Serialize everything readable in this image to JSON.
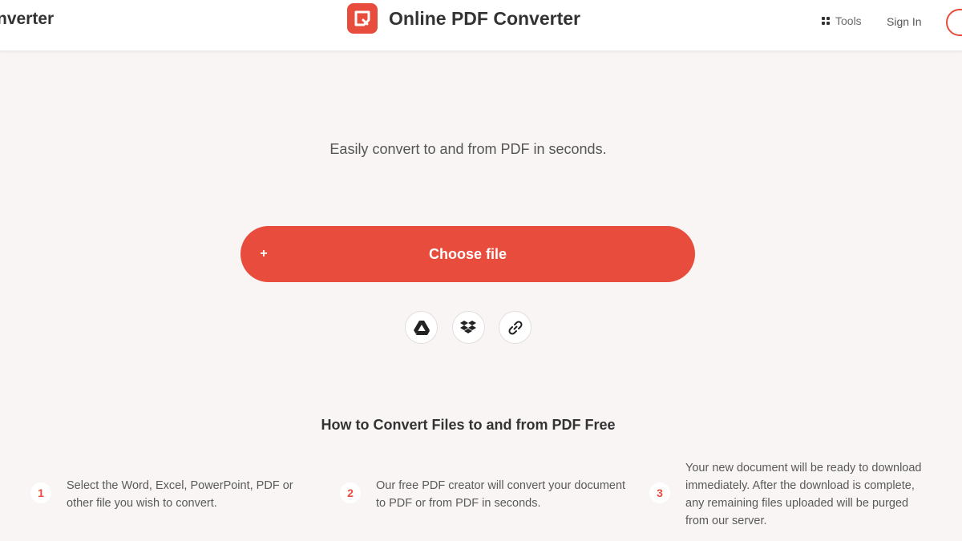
{
  "header": {
    "left_title": "nverter",
    "brand_name": "Online PDF Converter",
    "tools_label": "Tools",
    "signin_label": "Sign In"
  },
  "hero": {
    "tagline": "Easily convert to and from PDF in seconds.",
    "choose_label": "Choose file",
    "choose_plus": "+",
    "sources": [
      "google-drive-icon",
      "dropbox-icon",
      "link-icon"
    ]
  },
  "how": {
    "title": "How to Convert Files to and from PDF Free",
    "steps": [
      {
        "num": "1",
        "text": "Select the Word, Excel, PowerPoint, PDF or other file you wish to convert."
      },
      {
        "num": "2",
        "text": "Our free PDF creator will convert your document to PDF or from PDF in seconds."
      },
      {
        "num": "3",
        "text": "Your new document will be ready to download immediately. After the download is complete, any remaining files uploaded will be purged from our server."
      }
    ]
  },
  "colors": {
    "accent": "#e84c3d",
    "background": "#f8f5f4",
    "header_bg": "#ffffff"
  }
}
